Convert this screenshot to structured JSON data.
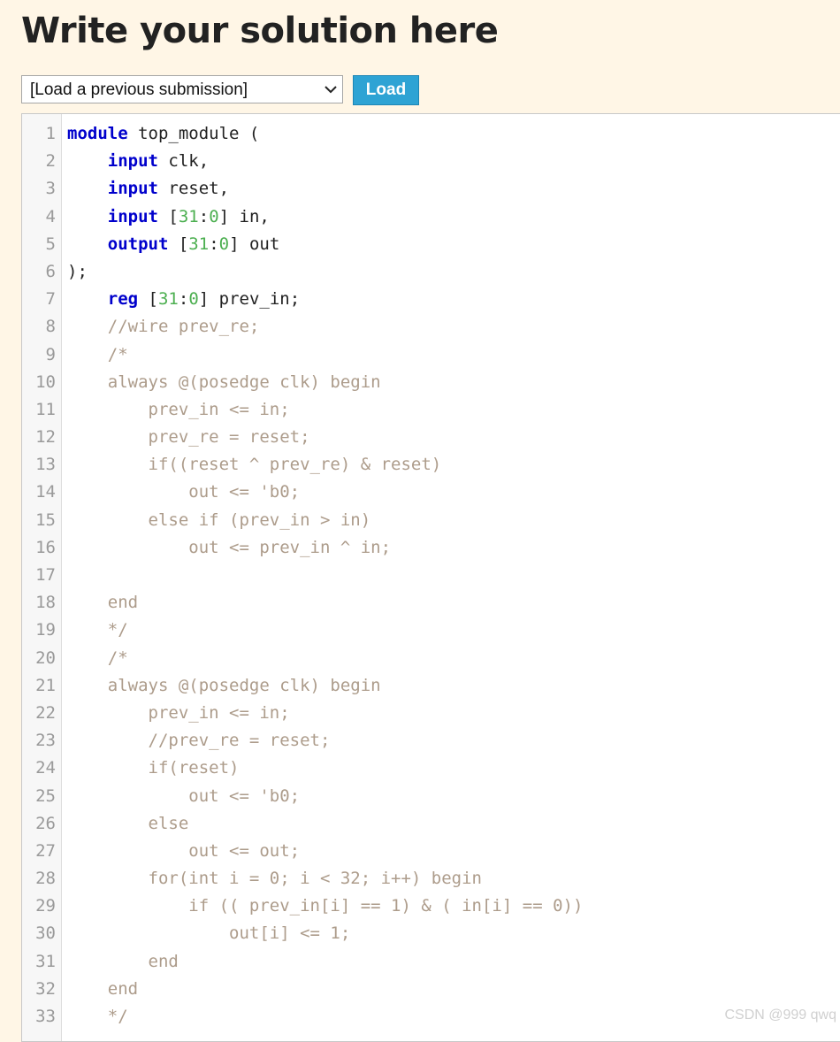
{
  "page": {
    "heading": "Write your solution here"
  },
  "toolbar": {
    "select_value": "[Load a previous submission]",
    "load_label": "Load"
  },
  "colors": {
    "background": "#fff6e6",
    "keyword": "#0000cc",
    "number": "#4caf50",
    "comment": "#ad9c8b",
    "button": "#2ea3d4"
  },
  "editor": {
    "lines": [
      {
        "n": "1",
        "tokens": [
          {
            "t": "module",
            "c": "kw"
          },
          {
            "t": " top_module (",
            "c": ""
          }
        ]
      },
      {
        "n": "2",
        "tokens": [
          {
            "t": "    ",
            "c": ""
          },
          {
            "t": "input",
            "c": "kw"
          },
          {
            "t": " clk,",
            "c": ""
          }
        ]
      },
      {
        "n": "3",
        "tokens": [
          {
            "t": "    ",
            "c": ""
          },
          {
            "t": "input",
            "c": "kw"
          },
          {
            "t": " reset,",
            "c": ""
          }
        ]
      },
      {
        "n": "4",
        "tokens": [
          {
            "t": "    ",
            "c": ""
          },
          {
            "t": "input",
            "c": "kw"
          },
          {
            "t": " [",
            "c": ""
          },
          {
            "t": "31",
            "c": "num"
          },
          {
            "t": ":",
            "c": ""
          },
          {
            "t": "0",
            "c": "num"
          },
          {
            "t": "] in,",
            "c": ""
          }
        ]
      },
      {
        "n": "5",
        "tokens": [
          {
            "t": "    ",
            "c": ""
          },
          {
            "t": "output",
            "c": "kw"
          },
          {
            "t": " [",
            "c": ""
          },
          {
            "t": "31",
            "c": "num"
          },
          {
            "t": ":",
            "c": ""
          },
          {
            "t": "0",
            "c": "num"
          },
          {
            "t": "] out",
            "c": ""
          }
        ]
      },
      {
        "n": "6",
        "tokens": [
          {
            "t": ");",
            "c": ""
          }
        ]
      },
      {
        "n": "7",
        "tokens": [
          {
            "t": "    ",
            "c": ""
          },
          {
            "t": "reg",
            "c": "kw"
          },
          {
            "t": " [",
            "c": ""
          },
          {
            "t": "31",
            "c": "num"
          },
          {
            "t": ":",
            "c": ""
          },
          {
            "t": "0",
            "c": "num"
          },
          {
            "t": "] prev_in;",
            "c": ""
          }
        ]
      },
      {
        "n": "8",
        "tokens": [
          {
            "t": "    //wire prev_re;",
            "c": "cm"
          }
        ]
      },
      {
        "n": "9",
        "tokens": [
          {
            "t": "    /*",
            "c": "cm"
          }
        ]
      },
      {
        "n": "10",
        "tokens": [
          {
            "t": "    always @(posedge clk) begin",
            "c": "cm"
          }
        ]
      },
      {
        "n": "11",
        "tokens": [
          {
            "t": "        prev_in <= in;",
            "c": "cm"
          }
        ]
      },
      {
        "n": "12",
        "tokens": [
          {
            "t": "        prev_re = reset;",
            "c": "cm"
          }
        ]
      },
      {
        "n": "13",
        "tokens": [
          {
            "t": "        if((reset ^ prev_re) & reset)",
            "c": "cm"
          }
        ]
      },
      {
        "n": "14",
        "tokens": [
          {
            "t": "            out <= 'b0;",
            "c": "cm"
          }
        ]
      },
      {
        "n": "15",
        "tokens": [
          {
            "t": "        else if (prev_in > in)",
            "c": "cm"
          }
        ]
      },
      {
        "n": "16",
        "tokens": [
          {
            "t": "            out <= prev_in ^ in;",
            "c": "cm"
          }
        ]
      },
      {
        "n": "17",
        "tokens": [
          {
            "t": "",
            "c": "cm"
          }
        ]
      },
      {
        "n": "18",
        "tokens": [
          {
            "t": "    end",
            "c": "cm"
          }
        ]
      },
      {
        "n": "19",
        "tokens": [
          {
            "t": "    */",
            "c": "cm"
          }
        ]
      },
      {
        "n": "20",
        "tokens": [
          {
            "t": "    /*",
            "c": "cm"
          }
        ]
      },
      {
        "n": "21",
        "tokens": [
          {
            "t": "    always @(posedge clk) begin",
            "c": "cm"
          }
        ]
      },
      {
        "n": "22",
        "tokens": [
          {
            "t": "        prev_in <= in;",
            "c": "cm"
          }
        ]
      },
      {
        "n": "23",
        "tokens": [
          {
            "t": "        //prev_re = reset;",
            "c": "cm"
          }
        ]
      },
      {
        "n": "24",
        "tokens": [
          {
            "t": "        if(reset)",
            "c": "cm"
          }
        ]
      },
      {
        "n": "25",
        "tokens": [
          {
            "t": "            out <= 'b0;",
            "c": "cm"
          }
        ]
      },
      {
        "n": "26",
        "tokens": [
          {
            "t": "        else",
            "c": "cm"
          }
        ]
      },
      {
        "n": "27",
        "tokens": [
          {
            "t": "            out <= out;",
            "c": "cm"
          }
        ]
      },
      {
        "n": "28",
        "tokens": [
          {
            "t": "        for(int i = 0; i < 32; i++) begin",
            "c": "cm"
          }
        ]
      },
      {
        "n": "29",
        "tokens": [
          {
            "t": "            if (( prev_in[i] == 1) & ( in[i] == 0))",
            "c": "cm"
          }
        ]
      },
      {
        "n": "30",
        "tokens": [
          {
            "t": "                out[i] <= 1;",
            "c": "cm"
          }
        ]
      },
      {
        "n": "31",
        "tokens": [
          {
            "t": "        end",
            "c": "cm"
          }
        ]
      },
      {
        "n": "32",
        "tokens": [
          {
            "t": "    end",
            "c": "cm"
          }
        ]
      },
      {
        "n": "33",
        "tokens": [
          {
            "t": "    */",
            "c": "cm"
          }
        ]
      }
    ]
  },
  "watermark": "CSDN @999 qwq"
}
